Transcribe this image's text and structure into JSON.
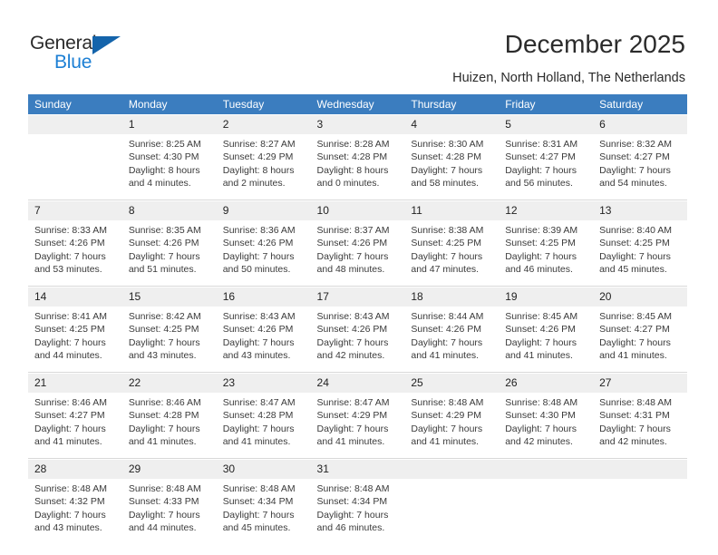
{
  "brand": {
    "name_part1": "General",
    "name_part2": "Blue",
    "accent_color": "#1c7fd4",
    "triangle_color": "#1464ab"
  },
  "header": {
    "title": "December 2025",
    "subtitle": "Huizen, North Holland, The Netherlands",
    "header_bar_color": "#3b7dbf"
  },
  "weekdays": [
    "Sunday",
    "Monday",
    "Tuesday",
    "Wednesday",
    "Thursday",
    "Friday",
    "Saturday"
  ],
  "weeks": [
    [
      {
        "day": "",
        "lines": []
      },
      {
        "day": "1",
        "lines": [
          "Sunrise: 8:25 AM",
          "Sunset: 4:30 PM",
          "Daylight: 8 hours",
          "and 4 minutes."
        ]
      },
      {
        "day": "2",
        "lines": [
          "Sunrise: 8:27 AM",
          "Sunset: 4:29 PM",
          "Daylight: 8 hours",
          "and 2 minutes."
        ]
      },
      {
        "day": "3",
        "lines": [
          "Sunrise: 8:28 AM",
          "Sunset: 4:28 PM",
          "Daylight: 8 hours",
          "and 0 minutes."
        ]
      },
      {
        "day": "4",
        "lines": [
          "Sunrise: 8:30 AM",
          "Sunset: 4:28 PM",
          "Daylight: 7 hours",
          "and 58 minutes."
        ]
      },
      {
        "day": "5",
        "lines": [
          "Sunrise: 8:31 AM",
          "Sunset: 4:27 PM",
          "Daylight: 7 hours",
          "and 56 minutes."
        ]
      },
      {
        "day": "6",
        "lines": [
          "Sunrise: 8:32 AM",
          "Sunset: 4:27 PM",
          "Daylight: 7 hours",
          "and 54 minutes."
        ]
      }
    ],
    [
      {
        "day": "7",
        "lines": [
          "Sunrise: 8:33 AM",
          "Sunset: 4:26 PM",
          "Daylight: 7 hours",
          "and 53 minutes."
        ]
      },
      {
        "day": "8",
        "lines": [
          "Sunrise: 8:35 AM",
          "Sunset: 4:26 PM",
          "Daylight: 7 hours",
          "and 51 minutes."
        ]
      },
      {
        "day": "9",
        "lines": [
          "Sunrise: 8:36 AM",
          "Sunset: 4:26 PM",
          "Daylight: 7 hours",
          "and 50 minutes."
        ]
      },
      {
        "day": "10",
        "lines": [
          "Sunrise: 8:37 AM",
          "Sunset: 4:26 PM",
          "Daylight: 7 hours",
          "and 48 minutes."
        ]
      },
      {
        "day": "11",
        "lines": [
          "Sunrise: 8:38 AM",
          "Sunset: 4:25 PM",
          "Daylight: 7 hours",
          "and 47 minutes."
        ]
      },
      {
        "day": "12",
        "lines": [
          "Sunrise: 8:39 AM",
          "Sunset: 4:25 PM",
          "Daylight: 7 hours",
          "and 46 minutes."
        ]
      },
      {
        "day": "13",
        "lines": [
          "Sunrise: 8:40 AM",
          "Sunset: 4:25 PM",
          "Daylight: 7 hours",
          "and 45 minutes."
        ]
      }
    ],
    [
      {
        "day": "14",
        "lines": [
          "Sunrise: 8:41 AM",
          "Sunset: 4:25 PM",
          "Daylight: 7 hours",
          "and 44 minutes."
        ]
      },
      {
        "day": "15",
        "lines": [
          "Sunrise: 8:42 AM",
          "Sunset: 4:25 PM",
          "Daylight: 7 hours",
          "and 43 minutes."
        ]
      },
      {
        "day": "16",
        "lines": [
          "Sunrise: 8:43 AM",
          "Sunset: 4:26 PM",
          "Daylight: 7 hours",
          "and 43 minutes."
        ]
      },
      {
        "day": "17",
        "lines": [
          "Sunrise: 8:43 AM",
          "Sunset: 4:26 PM",
          "Daylight: 7 hours",
          "and 42 minutes."
        ]
      },
      {
        "day": "18",
        "lines": [
          "Sunrise: 8:44 AM",
          "Sunset: 4:26 PM",
          "Daylight: 7 hours",
          "and 41 minutes."
        ]
      },
      {
        "day": "19",
        "lines": [
          "Sunrise: 8:45 AM",
          "Sunset: 4:26 PM",
          "Daylight: 7 hours",
          "and 41 minutes."
        ]
      },
      {
        "day": "20",
        "lines": [
          "Sunrise: 8:45 AM",
          "Sunset: 4:27 PM",
          "Daylight: 7 hours",
          "and 41 minutes."
        ]
      }
    ],
    [
      {
        "day": "21",
        "lines": [
          "Sunrise: 8:46 AM",
          "Sunset: 4:27 PM",
          "Daylight: 7 hours",
          "and 41 minutes."
        ]
      },
      {
        "day": "22",
        "lines": [
          "Sunrise: 8:46 AM",
          "Sunset: 4:28 PM",
          "Daylight: 7 hours",
          "and 41 minutes."
        ]
      },
      {
        "day": "23",
        "lines": [
          "Sunrise: 8:47 AM",
          "Sunset: 4:28 PM",
          "Daylight: 7 hours",
          "and 41 minutes."
        ]
      },
      {
        "day": "24",
        "lines": [
          "Sunrise: 8:47 AM",
          "Sunset: 4:29 PM",
          "Daylight: 7 hours",
          "and 41 minutes."
        ]
      },
      {
        "day": "25",
        "lines": [
          "Sunrise: 8:48 AM",
          "Sunset: 4:29 PM",
          "Daylight: 7 hours",
          "and 41 minutes."
        ]
      },
      {
        "day": "26",
        "lines": [
          "Sunrise: 8:48 AM",
          "Sunset: 4:30 PM",
          "Daylight: 7 hours",
          "and 42 minutes."
        ]
      },
      {
        "day": "27",
        "lines": [
          "Sunrise: 8:48 AM",
          "Sunset: 4:31 PM",
          "Daylight: 7 hours",
          "and 42 minutes."
        ]
      }
    ],
    [
      {
        "day": "28",
        "lines": [
          "Sunrise: 8:48 AM",
          "Sunset: 4:32 PM",
          "Daylight: 7 hours",
          "and 43 minutes."
        ]
      },
      {
        "day": "29",
        "lines": [
          "Sunrise: 8:48 AM",
          "Sunset: 4:33 PM",
          "Daylight: 7 hours",
          "and 44 minutes."
        ]
      },
      {
        "day": "30",
        "lines": [
          "Sunrise: 8:48 AM",
          "Sunset: 4:34 PM",
          "Daylight: 7 hours",
          "and 45 minutes."
        ]
      },
      {
        "day": "31",
        "lines": [
          "Sunrise: 8:48 AM",
          "Sunset: 4:34 PM",
          "Daylight: 7 hours",
          "and 46 minutes."
        ]
      },
      {
        "day": "",
        "lines": []
      },
      {
        "day": "",
        "lines": []
      },
      {
        "day": "",
        "lines": []
      }
    ]
  ]
}
